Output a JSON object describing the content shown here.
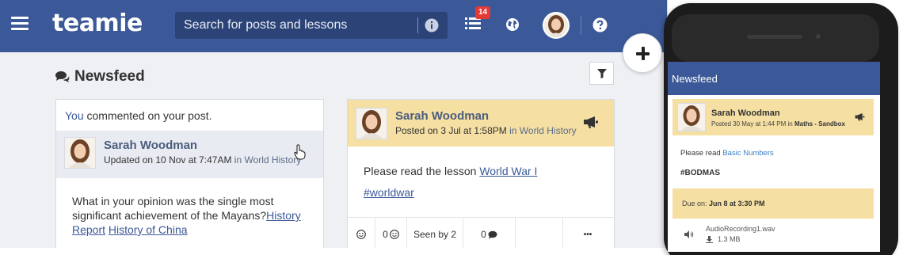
{
  "app": {
    "brand": "teamie",
    "accent_color": "#3b5998",
    "highlight_color": "#f5dfa3"
  },
  "header": {
    "menu_icon": "hamburger-menu-icon",
    "search": {
      "placeholder": "Search for posts and lessons",
      "value": ""
    },
    "notifications": {
      "icon": "list-icon",
      "count": "14"
    },
    "globe_icon": "globe-icon",
    "help_icon": "question-circle-icon"
  },
  "fab": {
    "icon": "plus-icon"
  },
  "newsfeed": {
    "title": "Newsfeed",
    "title_icon": "comments-icon",
    "filter_icon": "filter-icon"
  },
  "card1": {
    "activity_you": "You",
    "activity_rest": " commented on your post.",
    "author": "Sarah Woodman",
    "meta_prefix": "Updated on 10 Nov at 7:47AM",
    "meta_in": " in ",
    "meta_group": "World History",
    "body_text": "What in your opinion was the single most significant achievement of the Mayans?",
    "link1": "History Report",
    "link2": "History of China"
  },
  "card2": {
    "author": "Sarah Woodman",
    "meta_prefix": "Posted on 3 Jul at 1:58PM",
    "meta_in": " in ",
    "meta_group": "World History",
    "body_text": "Please read the lesson ",
    "lesson_link": "World War I",
    "hashtag": "#worldwar",
    "actions": {
      "react_icon": "smile-icon",
      "reactions_count": "0",
      "seen": "Seen by 2",
      "comments_count": "0",
      "more": "•••"
    }
  },
  "phone": {
    "title": "Newsfeed",
    "post": {
      "author": "Sarah Woodman",
      "meta_prefix": "Posted 30 May at 1:44 PM in ",
      "meta_group": "Maths - Sandbox"
    },
    "read_prefix": "Please read ",
    "read_link": "Basic Numbers",
    "hashtag": "#BODMAS",
    "due_label": "Due on: ",
    "due_value": "Jun 8 at 3:30 PM",
    "audio_file": "AudioRecording1.wav",
    "audio_size": "1.3 MB"
  }
}
